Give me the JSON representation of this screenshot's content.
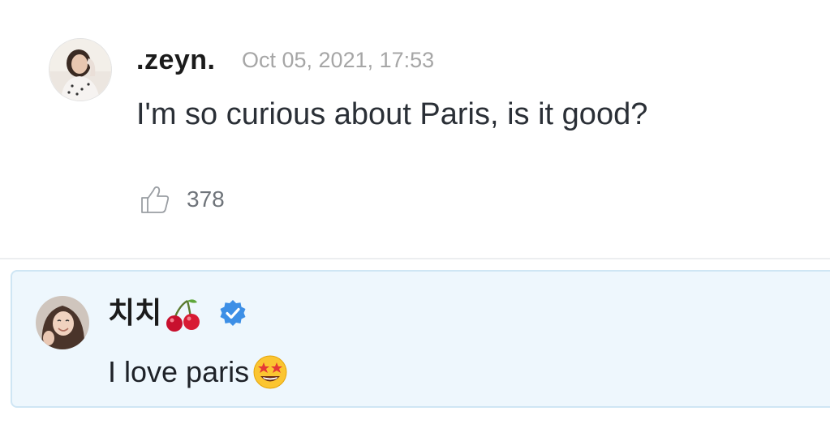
{
  "comment": {
    "username": ".zeyn.",
    "timestamp": "Oct 05, 2021, 17:53",
    "text": "I'm so curious about Paris, is it good?",
    "like_icon": "thumbs-up-icon",
    "like_count": "378"
  },
  "reply": {
    "username": "치치",
    "username_emoji": "cherry-icon",
    "verified_icon": "verified-badge-icon",
    "verified_color": "#3d8fe6",
    "text": "I love paris",
    "text_emoji": "star-struck-icon"
  },
  "colors": {
    "reply_background": "#eef7fd",
    "reply_border": "#cfe6f4",
    "timestamp": "#a6a6a6",
    "like_count": "#6f747a"
  }
}
